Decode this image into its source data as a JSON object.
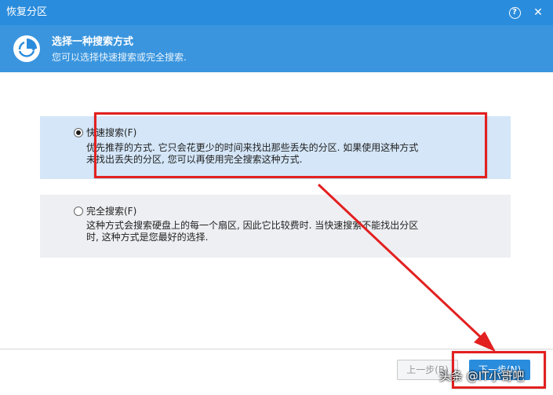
{
  "window": {
    "title": "恢复分区",
    "help_label": "?",
    "close_label": "✕"
  },
  "header": {
    "title": "选择一种搜索方式",
    "subtitle": "您可以选择快速搜索或完全搜索."
  },
  "options": [
    {
      "label": "快速搜索(F)",
      "desc_line1": "优先推荐的方式. 它只会花更少的时间来找出那些丢失的分区. 如果使用这种方式",
      "desc_line2": "未找出丢失的分区, 您可以再使用完全搜索这种方式.",
      "selected": true
    },
    {
      "label": "完全搜索(F)",
      "desc_line1": "这种方式会搜索硬盘上的每一个扇区, 因此它比较费时. 当快速搜索不能找出分区",
      "desc_line2": "时, 这种方式是您最好的选择.",
      "selected": false
    }
  ],
  "footer": {
    "prev_label": "上一步(B)",
    "next_label": "下一步(N)"
  },
  "watermark": "头条 @IT小哥吧",
  "colors": {
    "titlebar": "#2a8cdc",
    "header": "#3a95de",
    "selected_option_bg": "#d4e6f8",
    "unselected_option_bg": "#eeeff3",
    "annotation_red": "#e32020"
  },
  "icons": {
    "header_logo": "partition-recovery-icon",
    "help": "help-icon",
    "close": "close-icon"
  }
}
